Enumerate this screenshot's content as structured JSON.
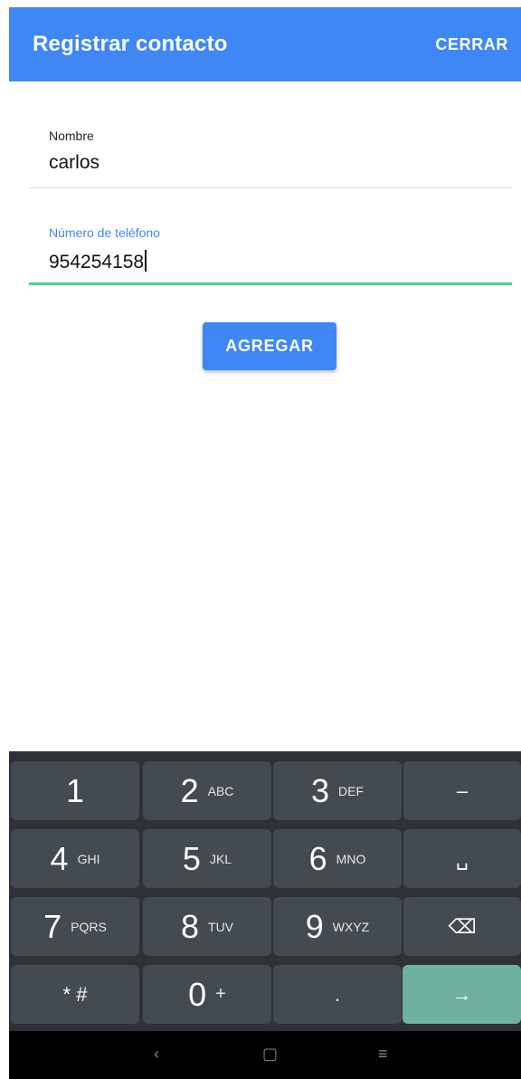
{
  "appbar": {
    "title": "Registrar contacto",
    "close_label": "CERRAR"
  },
  "form": {
    "name": {
      "label": "Nombre",
      "value": "carlos"
    },
    "phone": {
      "label": "Número de teléfono",
      "value": "954254158"
    },
    "submit_label": "AGREGAR"
  },
  "keyboard": {
    "rows": [
      [
        {
          "num": "1",
          "letters": ""
        },
        {
          "num": "2",
          "letters": "ABC"
        },
        {
          "num": "3",
          "letters": "DEF"
        },
        {
          "sym": "–"
        }
      ],
      [
        {
          "num": "4",
          "letters": "GHI"
        },
        {
          "num": "5",
          "letters": "JKL"
        },
        {
          "num": "6",
          "letters": "MNO"
        },
        {
          "sym": "␣"
        }
      ],
      [
        {
          "num": "7",
          "letters": "PQRS"
        },
        {
          "num": "8",
          "letters": "TUV"
        },
        {
          "num": "9",
          "letters": "WXYZ"
        },
        {
          "sym": "⌫"
        }
      ],
      [
        {
          "sym": "* #"
        },
        {
          "num": "0",
          "letters": "+"
        },
        {
          "sym": "."
        },
        {
          "sym": "→"
        }
      ]
    ]
  },
  "navbar": {
    "back": "‹",
    "home": "▢",
    "menu": "≡"
  },
  "colors": {
    "primary": "#3f87f5",
    "focus_line": "#4fd38a",
    "keyboard_bg": "#2e3236",
    "key_bg": "#434a50",
    "enter_key": "#6fb1a1"
  }
}
